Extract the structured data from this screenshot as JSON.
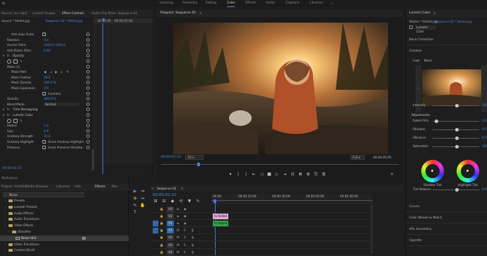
{
  "workspaces": {
    "items": [
      "Learning",
      "Assembly",
      "Editing",
      "Color",
      "Effects",
      "Audio",
      "Captions",
      "Libraries"
    ],
    "active": 3
  },
  "source_tabs": [
    "Source: (no clips)",
    "Lumetri Scopes",
    "Effect Controls",
    "Audio Clip Mixer: Sequence 02"
  ],
  "effect_controls": {
    "source_label": "Source * Rolled.jpg",
    "seq_label": "Sequence 02 * Rolled.jpg",
    "ruler_time": "00:00:00",
    "ruler_time2": "00:00:05:00",
    "rows": [
      {
        "name": "Anti-alias Scale",
        "value": "",
        "indent": 2,
        "checkbox": true
      },
      {
        "name": "Rotation",
        "value": "0.0",
        "indent": 1
      },
      {
        "name": "Anchor Point",
        "value": "1000.0     1500.0",
        "indent": 1
      },
      {
        "name": "Anti-flicker Filter",
        "value": "0.00",
        "indent": 1
      },
      {
        "name": "Opacity",
        "value": "",
        "indent": 0,
        "section": true
      },
      {
        "name": "",
        "value": "",
        "indent": 1,
        "shapes": true
      },
      {
        "name": "Mask (1)",
        "value": "",
        "indent": 1
      },
      {
        "name": "Mask Path",
        "value": "",
        "indent": 2,
        "transport": true
      },
      {
        "name": "Mask Feather",
        "value": "10.0",
        "indent": 2
      },
      {
        "name": "Mask Opacity",
        "value": "100.0 %",
        "indent": 2
      },
      {
        "name": "Mask Expansion",
        "value": "0.0",
        "indent": 2
      },
      {
        "name": "",
        "value": "Inverted",
        "indent": 2,
        "checkbox": true
      },
      {
        "name": "Opacity",
        "value": "100.0 %",
        "indent": 1
      },
      {
        "name": "Blend Mode",
        "value": "Normal",
        "indent": 1,
        "dropdown": true
      },
      {
        "name": "Time Remapping",
        "value": "",
        "indent": 0,
        "section": true
      },
      {
        "name": "Lumetri Color",
        "value": "",
        "indent": 0,
        "section": true
      },
      {
        "name": "",
        "value": "",
        "indent": 1,
        "shapes": true
      },
      {
        "name": "Radius",
        "value": "1.0",
        "indent": 1
      },
      {
        "name": "Size",
        "value": "4.9",
        "indent": 1
      },
      {
        "name": "Unsharp Strength",
        "value": "31.0",
        "indent": 1
      },
      {
        "name": "Unsharp Highlight",
        "value": "Grain Unsharp Highlight",
        "indent": 1,
        "checkbox": true
      },
      {
        "name": "Preserve",
        "value": "Grain Preserve Shadow",
        "indent": 1,
        "checkbox": true
      }
    ],
    "timecode": "00:00:01:10"
  },
  "program": {
    "tab": "Program: Sequence 02",
    "timecode": "00:00:01:10",
    "fit": "Fit",
    "quality": "Full",
    "duration": "00:00:05:00"
  },
  "project": {
    "tabs": [
      "Project: Untitled",
      "Media Browser",
      "Libraries",
      "Info",
      "Effects",
      "Mar"
    ],
    "active_tab": 4,
    "search": "Noise",
    "items": [
      {
        "label": "Presets",
        "indent": 1,
        "icon": "folder"
      },
      {
        "label": "Lumetri Presets",
        "indent": 1,
        "icon": "folder"
      },
      {
        "label": "Audio Effects",
        "indent": 1,
        "icon": "folder"
      },
      {
        "label": "Audio Transitions",
        "indent": 1,
        "icon": "folder"
      },
      {
        "label": "Video Effects",
        "indent": 1,
        "icon": "folder"
      },
      {
        "label": "Obsolete",
        "indent": 2,
        "icon": "folder"
      },
      {
        "label": "Noise HLS",
        "indent": 3,
        "icon": "fx",
        "selected": true
      },
      {
        "label": "Video Transitions",
        "indent": 1,
        "icon": "folder"
      },
      {
        "label": "Custom Bins8",
        "indent": 1,
        "icon": "folder"
      }
    ]
  },
  "timeline": {
    "tab": "Sequence 02",
    "timecode": "00:00:01:10",
    "ruler": [
      "00:00",
      "00:00:15:00",
      "00:00:30:00",
      "00:00:45:00",
      "00:01:00:00"
    ],
    "tracks": [
      {
        "name": "V3",
        "type": "video"
      },
      {
        "name": "V2",
        "type": "video"
      },
      {
        "name": "V1",
        "type": "video"
      },
      {
        "name": "A1",
        "type": "audio"
      },
      {
        "name": "A2",
        "type": "audio"
      },
      {
        "name": "A3",
        "type": "audio"
      },
      {
        "name": "A4",
        "type": "audio"
      }
    ],
    "clips": [
      {
        "label": "fx Rolled",
        "track": 1,
        "color": "#e7a8d8"
      },
      {
        "label": "fx Adjust",
        "track": 2,
        "color": "#35a24a"
      }
    ]
  },
  "lumetri": {
    "title": "Lumetri Color",
    "source_label": "Master * Rolled.jpg",
    "seq_label": "Sequence 02 * Rolled.jpg",
    "fx_toggle": "Lumetri Color",
    "sections": [
      "Basic Correction",
      "Creative",
      "Curves",
      "Color Wheels & Match",
      "HSL Secondary",
      "Vignette"
    ],
    "look_label": "Look",
    "look_value": "None",
    "sliders": [
      {
        "label": "Intensity",
        "value": "100.0",
        "pos": 0.5
      },
      {
        "label": "Faded Film",
        "value": "0.0",
        "pos": 0.05
      },
      {
        "label": "Sharpen",
        "value": "0.0",
        "pos": 0.5
      },
      {
        "label": "Vibrance",
        "value": "0.0",
        "pos": 0.5
      },
      {
        "label": "Saturation",
        "value": "100.0",
        "pos": 0.5
      },
      {
        "label": "Tint Balance",
        "value": "0.0",
        "pos": 0.5
      }
    ],
    "adjustments": "Adjustments",
    "wheels": [
      "Shadow Tint",
      "Highlight Tint"
    ]
  }
}
